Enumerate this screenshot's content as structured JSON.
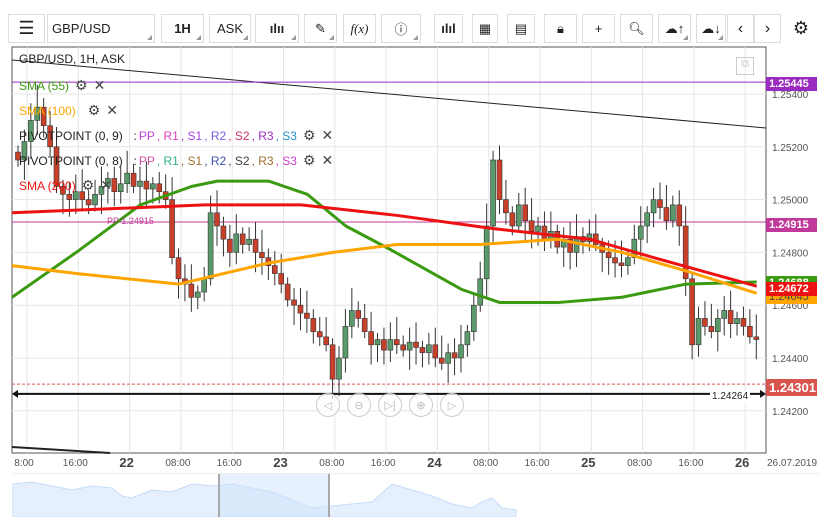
{
  "toolbar": {
    "symbol": "GBP/USD",
    "timeframe": "1H",
    "price_type": "ASK",
    "icons": [
      "menu-icon",
      "candlestick-icon",
      "pencil-icon",
      "function-icon",
      "info-icon",
      "volume-bars-icon",
      "calendar-icon",
      "news-icon",
      "lock-icon",
      "crosshair-icon",
      "zoom-chart-icon",
      "cloud-upload-icon",
      "cloud-download-icon",
      "chevron-left-icon",
      "chevron-right-icon",
      "gear-icon"
    ],
    "fx_label": "f(x)"
  },
  "legend": {
    "title": "GBP/USD, 1H, ASK",
    "sma55": "SMA (55)",
    "sma100": "SMA (100)",
    "sma200": "SMA (200)",
    "pivot1": {
      "label": "PIVOTPOINT (0, 9)",
      "sep": ":",
      "items": [
        {
          "t": "PP",
          "c": "#c040e0"
        },
        {
          "t": "R1",
          "c": "#e040c0"
        },
        {
          "t": "S1",
          "c": "#a040e0"
        },
        {
          "t": "R2",
          "c": "#7060e0"
        },
        {
          "t": "S2",
          "c": "#d03070"
        },
        {
          "t": "R3",
          "c": "#a030c0"
        },
        {
          "t": "S3",
          "c": "#2090d0"
        }
      ]
    },
    "pivot2": {
      "label": "PIVOTPOINT (0, 8)",
      "sep": ":",
      "items": [
        {
          "t": "PP",
          "c": "#d050a0"
        },
        {
          "t": "R1",
          "c": "#30b080"
        },
        {
          "t": "S1",
          "c": "#a07030"
        },
        {
          "t": "R2",
          "c": "#4050b0"
        },
        {
          "t": "S2",
          "c": "#404040"
        },
        {
          "t": "R3",
          "c": "#a07030"
        },
        {
          "t": "S3",
          "c": "#d040d0"
        }
      ]
    }
  },
  "colors": {
    "sma55": "#3a9a10",
    "sma100": "#ffa500",
    "sma200": "#ee1111",
    "up": "#5a9a6a",
    "down": "#c8402a",
    "purple": "#9a2ac0",
    "magenta": "#c0399a",
    "alert": "#d9534f"
  },
  "price_axis": {
    "ticks": [
      "1.25400",
      "1.25200",
      "1.25000",
      "1.24800",
      "1.24600",
      "1.24400",
      "1.24200"
    ]
  },
  "badges": {
    "r3": "1.25445",
    "pp": "1.24915",
    "sma55": "1.24688",
    "sma200": "1.24672",
    "sma100": "1.24645",
    "alert": "1.24301"
  },
  "annotations": {
    "pp_label": "PP 1.24915",
    "hline_label": "1.24264"
  },
  "time_axis": [
    "8:00",
    "16:00",
    "22",
    "08:00",
    "16:00",
    "23",
    "08:00",
    "16:00",
    "24",
    "08:00",
    "16:00",
    "25",
    "08:00",
    "16:00",
    "26"
  ],
  "date_label": "26.07.2019",
  "nav_buttons": [
    "scroll-left",
    "zoom-out",
    "reset",
    "zoom-in",
    "scroll-right"
  ],
  "chart_data": {
    "type": "candlestick",
    "ylim": [
      1.2415,
      1.2558
    ],
    "levels": {
      "r3": 1.25445,
      "pp": 1.24915,
      "alert": 1.24301,
      "hline": 1.24264
    },
    "closes": [
      1.2515,
      1.2522,
      1.253,
      1.2535,
      1.2528,
      1.252,
      1.2505,
      1.2502,
      1.25,
      1.2503,
      1.25,
      1.2498,
      1.2502,
      1.2505,
      1.2508,
      1.2503,
      1.2506,
      1.251,
      1.2505,
      1.2507,
      1.2504,
      1.2506,
      1.2503,
      1.25,
      1.2478,
      1.247,
      1.2468,
      1.2463,
      1.2465,
      1.247,
      1.2495,
      1.249,
      1.2485,
      1.248,
      1.2487,
      1.2483,
      1.2485,
      1.248,
      1.2478,
      1.2475,
      1.2472,
      1.2468,
      1.2462,
      1.246,
      1.2457,
      1.2455,
      1.245,
      1.2448,
      1.2445,
      1.2432,
      1.244,
      1.2452,
      1.2458,
      1.2455,
      1.245,
      1.2445,
      1.2447,
      1.2443,
      1.2447,
      1.2445,
      1.2443,
      1.2446,
      1.2444,
      1.2442,
      1.2445,
      1.244,
      1.2438,
      1.2442,
      1.244,
      1.2445,
      1.245,
      1.246,
      1.247,
      1.249,
      1.2515,
      1.25,
      1.2495,
      1.249,
      1.2498,
      1.2492,
      1.2488,
      1.249,
      1.2485,
      1.2488,
      1.2482,
      1.2485,
      1.248,
      1.2486,
      1.2484,
      1.2487,
      1.2483,
      1.248,
      1.2478,
      1.2476,
      1.2475,
      1.2478,
      1.2485,
      1.249,
      1.2495,
      1.25,
      1.2497,
      1.2492,
      1.2498,
      1.249,
      1.247,
      1.2445,
      1.2455,
      1.2452,
      1.245,
      1.2455,
      1.2458,
      1.2453,
      1.2455,
      1.2452,
      1.2448,
      1.2447
    ],
    "sma200": [
      [
        0,
        1.2495
      ],
      [
        30,
        1.2498
      ],
      [
        45,
        1.2498
      ],
      [
        60,
        1.2494
      ],
      [
        75,
        1.2489
      ],
      [
        90,
        1.2485
      ],
      [
        100,
        1.2478
      ],
      [
        116,
        1.24672
      ]
    ],
    "sma100": [
      [
        0,
        1.2475
      ],
      [
        10,
        1.2472
      ],
      [
        26,
        1.2468
      ],
      [
        40,
        1.2476
      ],
      [
        50,
        1.248
      ],
      [
        60,
        1.2483
      ],
      [
        73,
        1.2483
      ],
      [
        85,
        1.2485
      ],
      [
        95,
        1.248
      ],
      [
        105,
        1.2473
      ],
      [
        116,
        1.24645
      ]
    ],
    "sma55": [
      [
        0,
        1.2463
      ],
      [
        10,
        1.248
      ],
      [
        20,
        1.2498
      ],
      [
        28,
        1.2505
      ],
      [
        32,
        1.2507
      ],
      [
        40,
        1.2507
      ],
      [
        46,
        1.2502
      ],
      [
        52,
        1.249
      ],
      [
        59,
        1.2481
      ],
      [
        70,
        1.2466
      ],
      [
        76,
        1.2461
      ],
      [
        85,
        1.2461
      ],
      [
        95,
        1.2463
      ],
      [
        105,
        1.2468
      ],
      [
        116,
        1.24688
      ]
    ]
  }
}
